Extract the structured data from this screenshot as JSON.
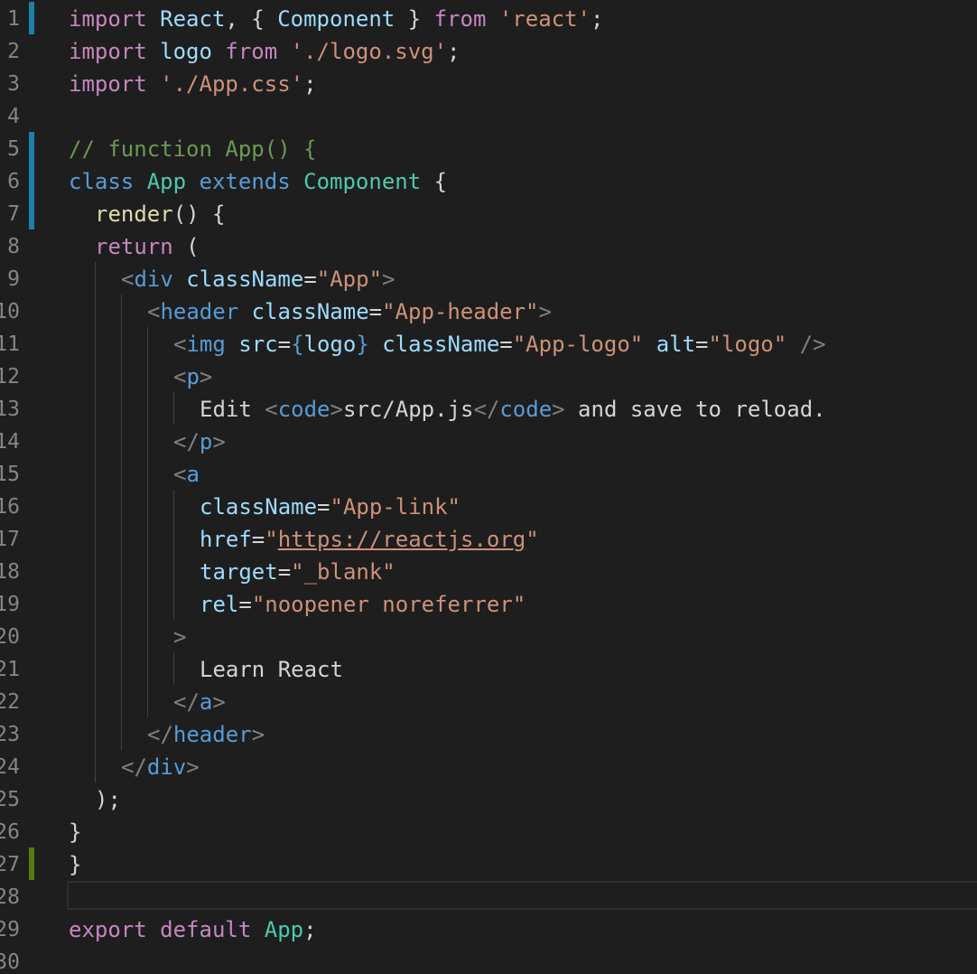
{
  "editor": {
    "colors": {
      "background": "#1e1e1e",
      "line_number": "#858585",
      "indent_guide": "#404040",
      "gutter_modified": "#1b81a8",
      "gutter_added": "#587c0c"
    },
    "lines": [
      {
        "number": "1",
        "gutter": "modified",
        "indent": 0,
        "tokens": [
          {
            "t": "import",
            "c": "#c586c0"
          },
          {
            "t": " ",
            "c": "#d4d4d4"
          },
          {
            "t": "React",
            "c": "#9cdcfe"
          },
          {
            "t": ", { ",
            "c": "#d4d4d4"
          },
          {
            "t": "Component",
            "c": "#9cdcfe"
          },
          {
            "t": " } ",
            "c": "#d4d4d4"
          },
          {
            "t": "from",
            "c": "#c586c0"
          },
          {
            "t": " ",
            "c": "#d4d4d4"
          },
          {
            "t": "'react'",
            "c": "#ce9178"
          },
          {
            "t": ";",
            "c": "#d4d4d4"
          }
        ]
      },
      {
        "number": "2",
        "gutter": "",
        "indent": 0,
        "tokens": [
          {
            "t": "import",
            "c": "#c586c0"
          },
          {
            "t": " ",
            "c": "#d4d4d4"
          },
          {
            "t": "logo",
            "c": "#9cdcfe"
          },
          {
            "t": " ",
            "c": "#d4d4d4"
          },
          {
            "t": "from",
            "c": "#c586c0"
          },
          {
            "t": " ",
            "c": "#d4d4d4"
          },
          {
            "t": "'./logo.svg'",
            "c": "#ce9178"
          },
          {
            "t": ";",
            "c": "#d4d4d4"
          }
        ]
      },
      {
        "number": "3",
        "gutter": "",
        "indent": 0,
        "tokens": [
          {
            "t": "import",
            "c": "#c586c0"
          },
          {
            "t": " ",
            "c": "#d4d4d4"
          },
          {
            "t": "'./App.css'",
            "c": "#ce9178"
          },
          {
            "t": ";",
            "c": "#d4d4d4"
          }
        ]
      },
      {
        "number": "4",
        "gutter": "",
        "indent": 0,
        "tokens": []
      },
      {
        "number": "5",
        "gutter": "modified",
        "indent": 0,
        "tokens": [
          {
            "t": "// function App() {",
            "c": "#6a9955"
          }
        ]
      },
      {
        "number": "6",
        "gutter": "modified",
        "indent": 0,
        "tokens": [
          {
            "t": "class",
            "c": "#569cd6"
          },
          {
            "t": " ",
            "c": "#d4d4d4"
          },
          {
            "t": "App",
            "c": "#4ec9b0"
          },
          {
            "t": " ",
            "c": "#d4d4d4"
          },
          {
            "t": "extends",
            "c": "#569cd6"
          },
          {
            "t": " ",
            "c": "#d4d4d4"
          },
          {
            "t": "Component",
            "c": "#4ec9b0"
          },
          {
            "t": " {",
            "c": "#d4d4d4"
          }
        ]
      },
      {
        "number": "7",
        "gutter": "modified",
        "indent": 1,
        "tokens": [
          {
            "t": "render",
            "c": "#dcdcaa"
          },
          {
            "t": "() {",
            "c": "#d4d4d4"
          }
        ]
      },
      {
        "number": "8",
        "gutter": "",
        "indent": 1,
        "tokens": [
          {
            "t": "return",
            "c": "#c586c0"
          },
          {
            "t": " (",
            "c": "#d4d4d4"
          }
        ]
      },
      {
        "number": "9",
        "gutter": "",
        "indent": 2,
        "tokens": [
          {
            "t": "<",
            "c": "#808080"
          },
          {
            "t": "div",
            "c": "#569cd6"
          },
          {
            "t": " ",
            "c": "#d4d4d4"
          },
          {
            "t": "className",
            "c": "#9cdcfe"
          },
          {
            "t": "=",
            "c": "#d4d4d4"
          },
          {
            "t": "\"App\"",
            "c": "#ce9178"
          },
          {
            "t": ">",
            "c": "#808080"
          }
        ]
      },
      {
        "number": "10",
        "gutter": "",
        "indent": 3,
        "tokens": [
          {
            "t": "<",
            "c": "#808080"
          },
          {
            "t": "header",
            "c": "#569cd6"
          },
          {
            "t": " ",
            "c": "#d4d4d4"
          },
          {
            "t": "className",
            "c": "#9cdcfe"
          },
          {
            "t": "=",
            "c": "#d4d4d4"
          },
          {
            "t": "\"App-header\"",
            "c": "#ce9178"
          },
          {
            "t": ">",
            "c": "#808080"
          }
        ]
      },
      {
        "number": "11",
        "gutter": "",
        "indent": 4,
        "tokens": [
          {
            "t": "<",
            "c": "#808080"
          },
          {
            "t": "img",
            "c": "#569cd6"
          },
          {
            "t": " ",
            "c": "#d4d4d4"
          },
          {
            "t": "src",
            "c": "#9cdcfe"
          },
          {
            "t": "=",
            "c": "#d4d4d4"
          },
          {
            "t": "{",
            "c": "#569cd6"
          },
          {
            "t": "logo",
            "c": "#9cdcfe"
          },
          {
            "t": "}",
            "c": "#569cd6"
          },
          {
            "t": " ",
            "c": "#d4d4d4"
          },
          {
            "t": "className",
            "c": "#9cdcfe"
          },
          {
            "t": "=",
            "c": "#d4d4d4"
          },
          {
            "t": "\"App-logo\"",
            "c": "#ce9178"
          },
          {
            "t": " ",
            "c": "#d4d4d4"
          },
          {
            "t": "alt",
            "c": "#9cdcfe"
          },
          {
            "t": "=",
            "c": "#d4d4d4"
          },
          {
            "t": "\"logo\"",
            "c": "#ce9178"
          },
          {
            "t": " />",
            "c": "#808080"
          }
        ]
      },
      {
        "number": "12",
        "gutter": "",
        "indent": 4,
        "tokens": [
          {
            "t": "<",
            "c": "#808080"
          },
          {
            "t": "p",
            "c": "#569cd6"
          },
          {
            "t": ">",
            "c": "#808080"
          }
        ]
      },
      {
        "number": "13",
        "gutter": "",
        "indent": 5,
        "tokens": [
          {
            "t": "Edit ",
            "c": "#d4d4d4"
          },
          {
            "t": "<",
            "c": "#808080"
          },
          {
            "t": "code",
            "c": "#569cd6"
          },
          {
            "t": ">",
            "c": "#808080"
          },
          {
            "t": "src/App.js",
            "c": "#d4d4d4"
          },
          {
            "t": "</",
            "c": "#808080"
          },
          {
            "t": "code",
            "c": "#569cd6"
          },
          {
            "t": ">",
            "c": "#808080"
          },
          {
            "t": " and save to reload.",
            "c": "#d4d4d4"
          }
        ]
      },
      {
        "number": "14",
        "gutter": "",
        "indent": 4,
        "tokens": [
          {
            "t": "</",
            "c": "#808080"
          },
          {
            "t": "p",
            "c": "#569cd6"
          },
          {
            "t": ">",
            "c": "#808080"
          }
        ]
      },
      {
        "number": "15",
        "gutter": "",
        "indent": 4,
        "tokens": [
          {
            "t": "<",
            "c": "#808080"
          },
          {
            "t": "a",
            "c": "#569cd6"
          }
        ]
      },
      {
        "number": "16",
        "gutter": "",
        "indent": 5,
        "tokens": [
          {
            "t": "className",
            "c": "#9cdcfe"
          },
          {
            "t": "=",
            "c": "#d4d4d4"
          },
          {
            "t": "\"App-link\"",
            "c": "#ce9178"
          }
        ]
      },
      {
        "number": "17",
        "gutter": "",
        "indent": 5,
        "tokens": [
          {
            "t": "href",
            "c": "#9cdcfe"
          },
          {
            "t": "=",
            "c": "#d4d4d4"
          },
          {
            "t": "\"",
            "c": "#ce9178"
          },
          {
            "t": "https://reactjs.org",
            "c": "#ce9178",
            "link": true
          },
          {
            "t": "\"",
            "c": "#ce9178"
          }
        ]
      },
      {
        "number": "18",
        "gutter": "",
        "indent": 5,
        "tokens": [
          {
            "t": "target",
            "c": "#9cdcfe"
          },
          {
            "t": "=",
            "c": "#d4d4d4"
          },
          {
            "t": "\"_blank\"",
            "c": "#ce9178"
          }
        ]
      },
      {
        "number": "19",
        "gutter": "",
        "indent": 5,
        "tokens": [
          {
            "t": "rel",
            "c": "#9cdcfe"
          },
          {
            "t": "=",
            "c": "#d4d4d4"
          },
          {
            "t": "\"noopener noreferrer\"",
            "c": "#ce9178"
          }
        ]
      },
      {
        "number": "20",
        "gutter": "",
        "indent": 4,
        "tokens": [
          {
            "t": ">",
            "c": "#808080"
          }
        ]
      },
      {
        "number": "21",
        "gutter": "",
        "indent": 5,
        "tokens": [
          {
            "t": "Learn React",
            "c": "#d4d4d4"
          }
        ]
      },
      {
        "number": "22",
        "gutter": "",
        "indent": 4,
        "tokens": [
          {
            "t": "</",
            "c": "#808080"
          },
          {
            "t": "a",
            "c": "#569cd6"
          },
          {
            "t": ">",
            "c": "#808080"
          }
        ]
      },
      {
        "number": "23",
        "gutter": "",
        "indent": 3,
        "tokens": [
          {
            "t": "</",
            "c": "#808080"
          },
          {
            "t": "header",
            "c": "#569cd6"
          },
          {
            "t": ">",
            "c": "#808080"
          }
        ]
      },
      {
        "number": "24",
        "gutter": "",
        "indent": 2,
        "tokens": [
          {
            "t": "</",
            "c": "#808080"
          },
          {
            "t": "div",
            "c": "#569cd6"
          },
          {
            "t": ">",
            "c": "#808080"
          }
        ]
      },
      {
        "number": "25",
        "gutter": "",
        "indent": 1,
        "tokens": [
          {
            "t": ");",
            "c": "#d4d4d4"
          }
        ]
      },
      {
        "number": "26",
        "gutter": "",
        "indent": 0,
        "tokens": [
          {
            "t": "}",
            "c": "#d4d4d4"
          }
        ]
      },
      {
        "number": "27",
        "gutter": "added",
        "indent": 0,
        "tokens": [
          {
            "t": "}",
            "c": "#d4d4d4"
          }
        ]
      },
      {
        "number": "28",
        "gutter": "",
        "indent": 0,
        "current": true,
        "tokens": []
      },
      {
        "number": "29",
        "gutter": "",
        "indent": 0,
        "tokens": [
          {
            "t": "export",
            "c": "#c586c0"
          },
          {
            "t": " ",
            "c": "#d4d4d4"
          },
          {
            "t": "default",
            "c": "#c586c0"
          },
          {
            "t": " ",
            "c": "#d4d4d4"
          },
          {
            "t": "App",
            "c": "#4ec9b0"
          },
          {
            "t": ";",
            "c": "#d4d4d4"
          }
        ]
      },
      {
        "number": "30",
        "gutter": "",
        "indent": 0,
        "tokens": []
      }
    ]
  }
}
